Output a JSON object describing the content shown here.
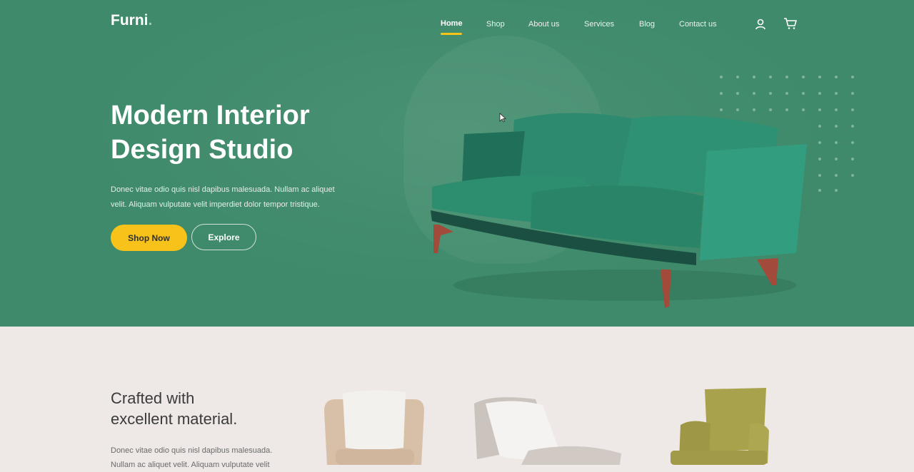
{
  "brand": {
    "name": "Furni",
    "dot": "."
  },
  "nav": {
    "items": [
      {
        "label": "Home",
        "active": true
      },
      {
        "label": "Shop"
      },
      {
        "label": "About us"
      },
      {
        "label": "Services"
      },
      {
        "label": "Blog"
      },
      {
        "label": "Contact us"
      }
    ],
    "icons": [
      "user-icon",
      "cart-icon"
    ]
  },
  "hero": {
    "title_line1": "Modern Interior",
    "title_line2": "Design Studio",
    "description": "Donec vitae odio quis nisl dapibus malesuada. Nullam ac aliquet velit. Aliquam vulputate velit imperdiet dolor tempor tristique.",
    "primary_button": "Shop Now",
    "secondary_button": "Explore",
    "image": "green-sofa"
  },
  "section2": {
    "title_line1": "Crafted with",
    "title_line2": "excellent material.",
    "description": "Donec vitae odio quis nisl dapibus malesuada. Nullam ac aliquet velit. Aliquam vulputate velit",
    "products": [
      "beige-armchair",
      "grey-lounge-chair",
      "olive-armchair"
    ]
  },
  "colors": {
    "hero_bg": "#3e8a6a",
    "accent_yellow": "#f7c31b",
    "section_bg": "#eee8e6"
  }
}
